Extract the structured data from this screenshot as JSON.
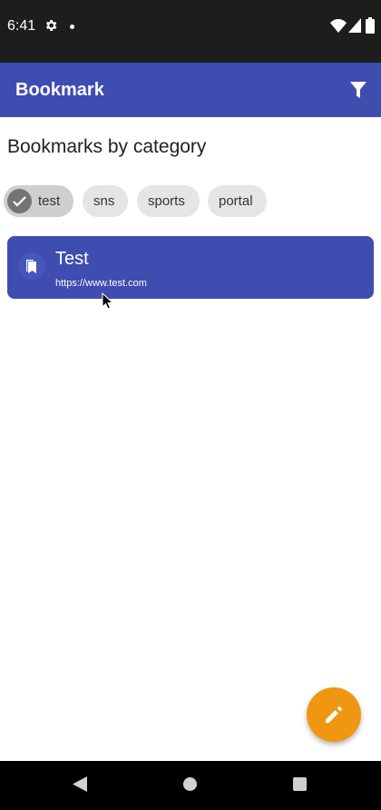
{
  "status_bar": {
    "time": "6:41"
  },
  "app_bar": {
    "title": "Bookmark"
  },
  "section": {
    "title": "Bookmarks by category"
  },
  "chips": [
    {
      "label": "test",
      "selected": true
    },
    {
      "label": "sns",
      "selected": false
    },
    {
      "label": "sports",
      "selected": false
    },
    {
      "label": "portal",
      "selected": false
    }
  ],
  "bookmarks": [
    {
      "title": "Test",
      "url": "https://www.test.com"
    }
  ],
  "colors": {
    "primary": "#3f4cb0",
    "accent": "#f09712",
    "status_bar": "#1d1d1b"
  },
  "icons": {
    "filter": "filter-icon",
    "bookmark": "bookmarks-icon",
    "fab": "pencil-icon",
    "settings": "gear-icon"
  }
}
